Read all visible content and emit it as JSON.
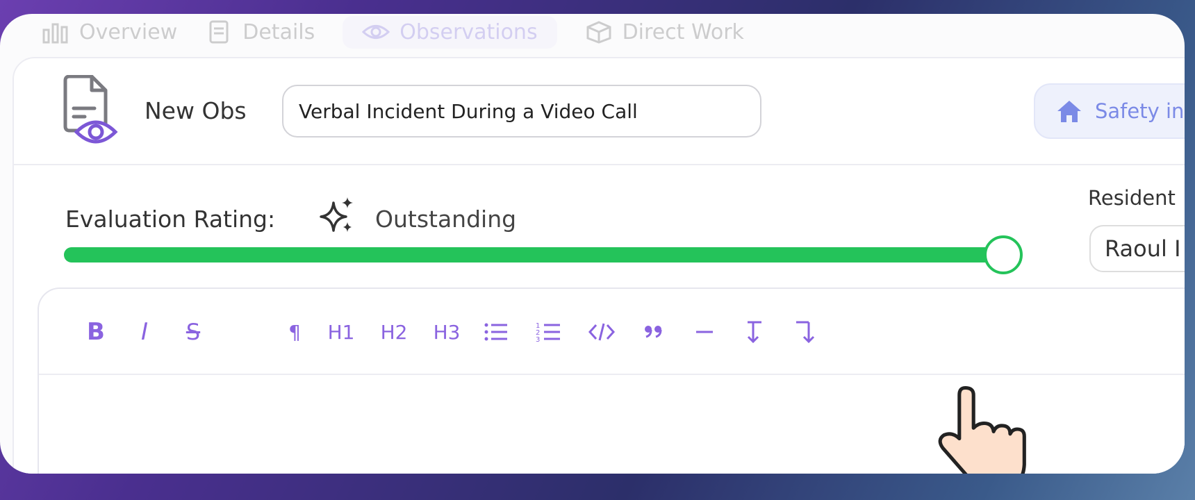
{
  "tabs": [
    {
      "label": "Overview",
      "icon": "bar-chart-icon"
    },
    {
      "label": "Details",
      "icon": "document-icon"
    },
    {
      "label": "Observations",
      "icon": "eye-icon"
    },
    {
      "label": "Direct Work",
      "icon": "box-icon"
    }
  ],
  "header": {
    "label": "New Obs",
    "title_value": "Verbal Incident During a Video Call",
    "chip_label": "Safety in"
  },
  "evaluation": {
    "label": "Evaluation Rating:",
    "value": "Outstanding",
    "level_fraction": 1.0
  },
  "resident": {
    "label": "Resident",
    "value": "Raoul I"
  },
  "toolbar": {
    "bold": "B",
    "italic": "I",
    "strike": "S",
    "paragraph": "¶",
    "h1": "H1",
    "h2": "H2",
    "h3": "H3"
  },
  "colors": {
    "accent": "#8a63e0",
    "slider": "#24c35a",
    "chip": "#7b8ae6"
  }
}
